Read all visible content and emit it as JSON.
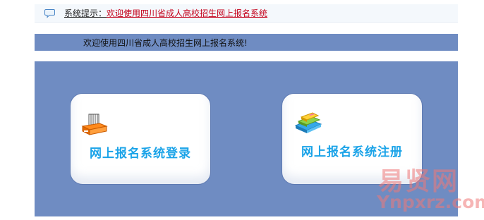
{
  "notice": {
    "icon": "speech-bubble-icon",
    "prefix": "系统提示：",
    "link_text": "欢迎使用四川省成人高校招生网上报名系统"
  },
  "welcome": {
    "text": "欢迎使用四川省成人高校招生网上报名系统!"
  },
  "cards": {
    "login": {
      "label": "网上报名系统登录",
      "icon": "computer-icon"
    },
    "register": {
      "label": "网上报名系统注册",
      "icon": "books-icon"
    }
  },
  "watermark": {
    "cn": "易贤网",
    "en": "Ynpxrz.com"
  },
  "colors": {
    "panel": "#6f8cc2",
    "card_label": "#1aa3e8",
    "link": "#c4001a"
  }
}
